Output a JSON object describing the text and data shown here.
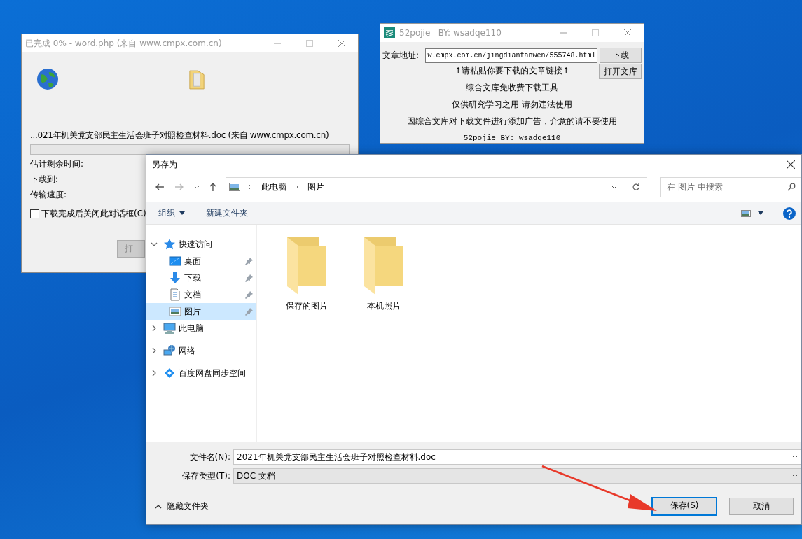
{
  "download_window": {
    "title": "已完成 0% - word.php (来自 www.cmpx.com.cn)",
    "file": "...021年机关党支部民主生活会班子对照检查材料.doc (来自 www.cmpx.com.cn)",
    "progress": {
      "level": 0
    },
    "fields": [
      "估计剩余时间:",
      "下载到:",
      "传输速度:"
    ],
    "close_when_done": {
      "label": "下载完成后关闭此对话框(C)",
      "checked": false
    },
    "button": "打"
  },
  "tool_window": {
    "title": "52pojie   BY: wsadqe110",
    "address_label": "文章地址:",
    "address_value": "w.cmpx.com.cn/jingdianfanwen/555748.html",
    "download_button": "下载",
    "open_button": "打开文库",
    "hint": "↑请粘贴你要下载的文章链接↑",
    "lines": [
      "综合文库免收费下载工具",
      "仅供研究学习之用 请勿违法使用",
      "因综合文库对下载文件进行添加广告，介意的请不要使用"
    ],
    "footer": "52pojie   BY: wsadqe110"
  },
  "save_dialog": {
    "title": "另存为",
    "breadcrumb": [
      "此电脑",
      "图片"
    ],
    "search": {
      "placeholder": "在 图片 中搜索"
    },
    "toolbar": [
      {
        "label": "组织",
        "kind": "menu"
      },
      {
        "label": "新建文件夹",
        "kind": "button"
      }
    ],
    "tree": [
      {
        "label": "快速访问",
        "kind": "star",
        "expanded": true,
        "selected": false,
        "children": [
          {
            "label": "桌面",
            "kind": "desktop",
            "pinned": true,
            "selected": false
          },
          {
            "label": "下载",
            "kind": "download",
            "pinned": true,
            "selected": false
          },
          {
            "label": "文档",
            "kind": "document",
            "pinned": true,
            "selected": false
          },
          {
            "label": "图片",
            "kind": "pictures",
            "pinned": true,
            "selected": true
          }
        ]
      },
      {
        "label": "此电脑",
        "kind": "computer",
        "expanded": false,
        "selected": false
      },
      {
        "label": "网络",
        "kind": "network",
        "expanded": false,
        "selected": false
      },
      {
        "label": "百度网盘同步空间",
        "kind": "cloud",
        "expanded": false,
        "selected": false
      }
    ],
    "files": [
      {
        "name": "保存的图片"
      },
      {
        "name": "本机照片"
      }
    ],
    "file_name": {
      "label": "文件名(N):",
      "value": "2021年机关党支部民主生活会班子对照检查材料.doc"
    },
    "file_type": {
      "label": "保存类型(T):",
      "value": "DOC 文档"
    },
    "hide_folders": "隐藏文件夹",
    "buttons": [
      {
        "label": "保存(S)",
        "kind": "primary"
      },
      {
        "label": "取消",
        "kind": "secondary"
      }
    ]
  }
}
